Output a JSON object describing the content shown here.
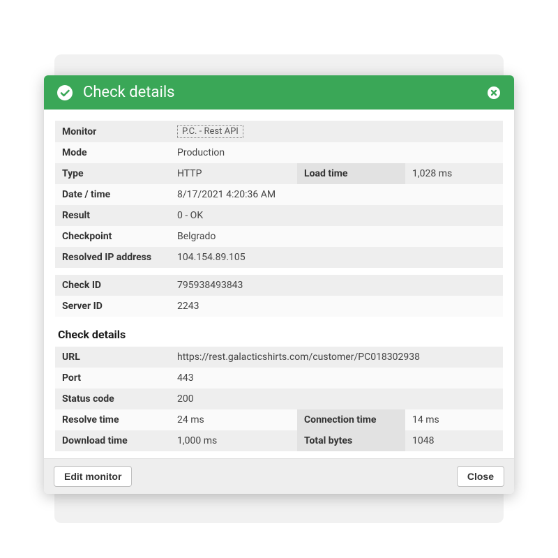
{
  "header": {
    "title": "Check details"
  },
  "section1": {
    "monitor_label": "Monitor",
    "monitor_value": "P.C. - Rest API",
    "mode_label": "Mode",
    "mode_value": "Production",
    "type_label": "Type",
    "type_value": "HTTP",
    "loadtime_label": "Load time",
    "loadtime_value": "1,028 ms",
    "datetime_label": "Date / time",
    "datetime_value": "8/17/2021 4:20:36 AM",
    "result_label": "Result",
    "result_value": "0 - OK",
    "checkpoint_label": "Checkpoint",
    "checkpoint_value": "Belgrado",
    "resolvedip_label": "Resolved IP address",
    "resolvedip_value": "104.154.89.105"
  },
  "section2": {
    "checkid_label": "Check ID",
    "checkid_value": "795938493843",
    "serverid_label": "Server ID",
    "serverid_value": "2243"
  },
  "section3": {
    "title": "Check details",
    "url_label": "URL",
    "url_value": "https://rest.galacticshirts.com/customer/PC018302938",
    "port_label": "Port",
    "port_value": "443",
    "statuscode_label": "Status code",
    "statuscode_value": "200",
    "resolvetime_label": "Resolve time",
    "resolvetime_value": "24 ms",
    "connectiontime_label": "Connection time",
    "connectiontime_value": "14 ms",
    "downloadtime_label": "Download time",
    "downloadtime_value": "1,000 ms",
    "totalbytes_label": "Total bytes",
    "totalbytes_value": "1048"
  },
  "footer": {
    "edit_label": "Edit monitor",
    "close_label": "Close"
  }
}
